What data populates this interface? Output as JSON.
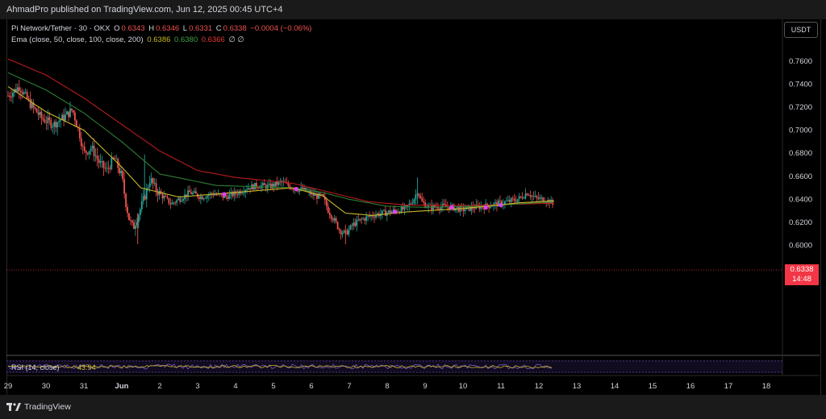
{
  "header": {
    "published": "AhmadPro published on TradingView.com, Jun 12, 2025 00:45 UTC+4"
  },
  "legend": {
    "pair": "Pi Network/Tether · 30 · OKX",
    "o_label": "O",
    "o_value": "0.6343",
    "h_label": "H",
    "h_value": "0.6346",
    "l_label": "L",
    "l_value": "0.6331",
    "c_label": "C",
    "c_value": "0.6338",
    "change": "−0.0004 (−0.06%)",
    "ema_label": "Ema (close, 50, close, 100, close, 200)",
    "ema50": "0.6386",
    "ema100": "0.6380",
    "ema200": "0.6366",
    "ema_extra": "∅ ∅"
  },
  "axis": {
    "currency": "USDT",
    "y_ticks": [
      "0.7600",
      "0.7400",
      "0.7200",
      "0.7000",
      "0.6800",
      "0.6600",
      "0.6400",
      "0.6200",
      "0.6000"
    ],
    "x_ticks": [
      "29",
      "30",
      "31",
      "Jun",
      "2",
      "3",
      "4",
      "5",
      "6",
      "7",
      "8",
      "9",
      "10",
      "11",
      "12",
      "13",
      "14",
      "15",
      "16",
      "17",
      "18"
    ]
  },
  "price_badge": {
    "price": "0.6338",
    "countdown": "14:48"
  },
  "rsi": {
    "label": "RSI (14, close)",
    "value": "43.94"
  },
  "footer": {
    "brand": "TradingView"
  },
  "colors": {
    "up": "#26a69a",
    "down": "#ef5350",
    "ema50": "#c9b92a",
    "ema100": "#2e7d32",
    "ema200": "#b71c1c",
    "rsi": "#7e57c2",
    "marker": "#e040fb"
  },
  "chart_data": {
    "type": "candlestick",
    "ylim": [
      0.59,
      0.77
    ],
    "x_range": [
      "May 29",
      "Jun 18"
    ],
    "close_series": [
      [
        0.0,
        0.73
      ],
      [
        0.3,
        0.738
      ],
      [
        0.6,
        0.722
      ],
      [
        0.9,
        0.71
      ],
      [
        1.2,
        0.705
      ],
      [
        1.5,
        0.712
      ],
      [
        1.7,
        0.718
      ],
      [
        1.9,
        0.695
      ],
      [
        2.0,
        0.68
      ],
      [
        2.2,
        0.685
      ],
      [
        2.4,
        0.672
      ],
      [
        2.6,
        0.665
      ],
      [
        2.8,
        0.676
      ],
      [
        3.0,
        0.66
      ],
      [
        3.1,
        0.638
      ],
      [
        3.2,
        0.622
      ],
      [
        3.3,
        0.615
      ],
      [
        3.45,
        0.628
      ],
      [
        3.6,
        0.642
      ],
      [
        3.75,
        0.658
      ],
      [
        3.9,
        0.648
      ],
      [
        4.1,
        0.642
      ],
      [
        4.3,
        0.636
      ],
      [
        4.5,
        0.64
      ],
      [
        4.8,
        0.646
      ],
      [
        5.1,
        0.642
      ],
      [
        5.4,
        0.645
      ],
      [
        5.7,
        0.642
      ],
      [
        6.0,
        0.645
      ],
      [
        6.3,
        0.65
      ],
      [
        6.6,
        0.652
      ],
      [
        6.9,
        0.651
      ],
      [
        7.2,
        0.655
      ],
      [
        7.5,
        0.65
      ],
      [
        7.8,
        0.648
      ],
      [
        8.1,
        0.643
      ],
      [
        8.3,
        0.642
      ],
      [
        8.45,
        0.63
      ],
      [
        8.6,
        0.622
      ],
      [
        8.75,
        0.613
      ],
      [
        8.9,
        0.61
      ],
      [
        9.1,
        0.618
      ],
      [
        9.3,
        0.622
      ],
      [
        9.6,
        0.626
      ],
      [
        9.9,
        0.628
      ],
      [
        10.2,
        0.63
      ],
      [
        10.5,
        0.632
      ],
      [
        10.7,
        0.64
      ],
      [
        10.8,
        0.648
      ],
      [
        10.9,
        0.638
      ],
      [
        11.1,
        0.633
      ],
      [
        11.4,
        0.634
      ],
      [
        11.7,
        0.633
      ],
      [
        12.0,
        0.631
      ],
      [
        12.3,
        0.633
      ],
      [
        12.6,
        0.634
      ],
      [
        12.9,
        0.636
      ],
      [
        13.2,
        0.638
      ],
      [
        13.5,
        0.641
      ],
      [
        13.7,
        0.646
      ],
      [
        13.9,
        0.641
      ],
      [
        14.1,
        0.64
      ],
      [
        14.3,
        0.638
      ],
      [
        14.4,
        0.6338
      ]
    ],
    "ema50": [
      [
        0.0,
        0.738
      ],
      [
        1.0,
        0.716
      ],
      [
        2.0,
        0.7
      ],
      [
        3.0,
        0.668
      ],
      [
        3.5,
        0.65
      ],
      [
        4.5,
        0.642
      ],
      [
        6.0,
        0.646
      ],
      [
        7.5,
        0.65
      ],
      [
        8.3,
        0.643
      ],
      [
        8.9,
        0.628
      ],
      [
        9.6,
        0.626
      ],
      [
        10.5,
        0.629
      ],
      [
        12.0,
        0.632
      ],
      [
        13.5,
        0.637
      ],
      [
        14.4,
        0.6386
      ]
    ],
    "ema100": [
      [
        0.0,
        0.75
      ],
      [
        1.0,
        0.735
      ],
      [
        2.0,
        0.715
      ],
      [
        3.0,
        0.69
      ],
      [
        4.0,
        0.662
      ],
      [
        5.5,
        0.652
      ],
      [
        7.5,
        0.65
      ],
      [
        8.3,
        0.646
      ],
      [
        9.0,
        0.64
      ],
      [
        10.0,
        0.634
      ],
      [
        11.0,
        0.633
      ],
      [
        12.5,
        0.634
      ],
      [
        14.4,
        0.638
      ]
    ],
    "ema200": [
      [
        0.0,
        0.762
      ],
      [
        1.0,
        0.748
      ],
      [
        2.0,
        0.728
      ],
      [
        3.0,
        0.705
      ],
      [
        4.0,
        0.682
      ],
      [
        5.0,
        0.665
      ],
      [
        6.0,
        0.659
      ],
      [
        7.5,
        0.654
      ],
      [
        8.5,
        0.646
      ],
      [
        9.5,
        0.638
      ],
      [
        10.5,
        0.635
      ],
      [
        12.0,
        0.6345
      ],
      [
        14.4,
        0.6366
      ]
    ],
    "cross_markers": [
      [
        5.7,
        0.6445
      ],
      [
        7.6,
        0.649
      ],
      [
        10.2,
        0.629
      ],
      [
        11.7,
        0.633
      ],
      [
        12.6,
        0.633
      ],
      [
        13.0,
        0.635
      ]
    ],
    "rsi_value": 43.94
  }
}
